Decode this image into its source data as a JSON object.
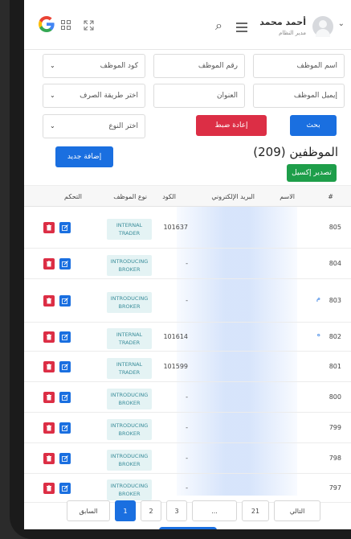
{
  "header": {
    "user_name": "أحمد محمد",
    "user_role": "مدير النظام"
  },
  "filters": {
    "employee_name": "اسم الموظف",
    "employee_number": "رقم الموظف",
    "employee_code": "كود الموظف",
    "employee_email": "إيميل الموظف",
    "address": "العنوان",
    "payment_method": "اختر طريقة الصرف",
    "type": "اختر النوع",
    "search_label": "بحث",
    "reset_label": "إعادة ضبط"
  },
  "page": {
    "title": "الموظفين (209)",
    "export_label": "تصدير إكسيل",
    "add_label": "إضافة جديد"
  },
  "table": {
    "headers": {
      "num": "#",
      "name": "الاسم",
      "email": "البريد الإلكتروني",
      "code": "الكود",
      "type": "نوع الموظف",
      "actions": "التحكم"
    },
    "rows": [
      {
        "num": "805",
        "code": "101637",
        "type1": "INTERNAL",
        "type2": "TRADER"
      },
      {
        "num": "804",
        "code": "-",
        "type1": "INTRODUCING",
        "type2": "BROKER"
      },
      {
        "num": "803",
        "code": "-",
        "type1": "INTRODUCING",
        "type2": "BROKER",
        "name_mark": "م"
      },
      {
        "num": "802",
        "code": "101614",
        "type1": "INTERNAL",
        "type2": "TRADER",
        "name_mark": "ه"
      },
      {
        "num": "801",
        "code": "101599",
        "type1": "INTERNAL",
        "type2": "TRADER"
      },
      {
        "num": "800",
        "code": "-",
        "type1": "INTRODUCING",
        "type2": "BROKER"
      },
      {
        "num": "799",
        "code": "-",
        "type1": "INTRODUCING",
        "type2": "BROKER"
      },
      {
        "num": "798",
        "code": "-",
        "type1": "INTRODUCING",
        "type2": "BROKER"
      },
      {
        "num": "797",
        "code": "-",
        "type1": "INTRODUCING",
        "type2": "BROKER"
      }
    ]
  },
  "pagination": {
    "prev": "السابق",
    "next": "التالي",
    "p1": "1",
    "p2": "2",
    "p3": "3",
    "dots": "...",
    "last": "21"
  },
  "colors": {
    "primary": "#1a6fe0",
    "danger": "#dc2e45",
    "success": "#1e9e4a",
    "badge_bg": "#e4f3f4"
  }
}
